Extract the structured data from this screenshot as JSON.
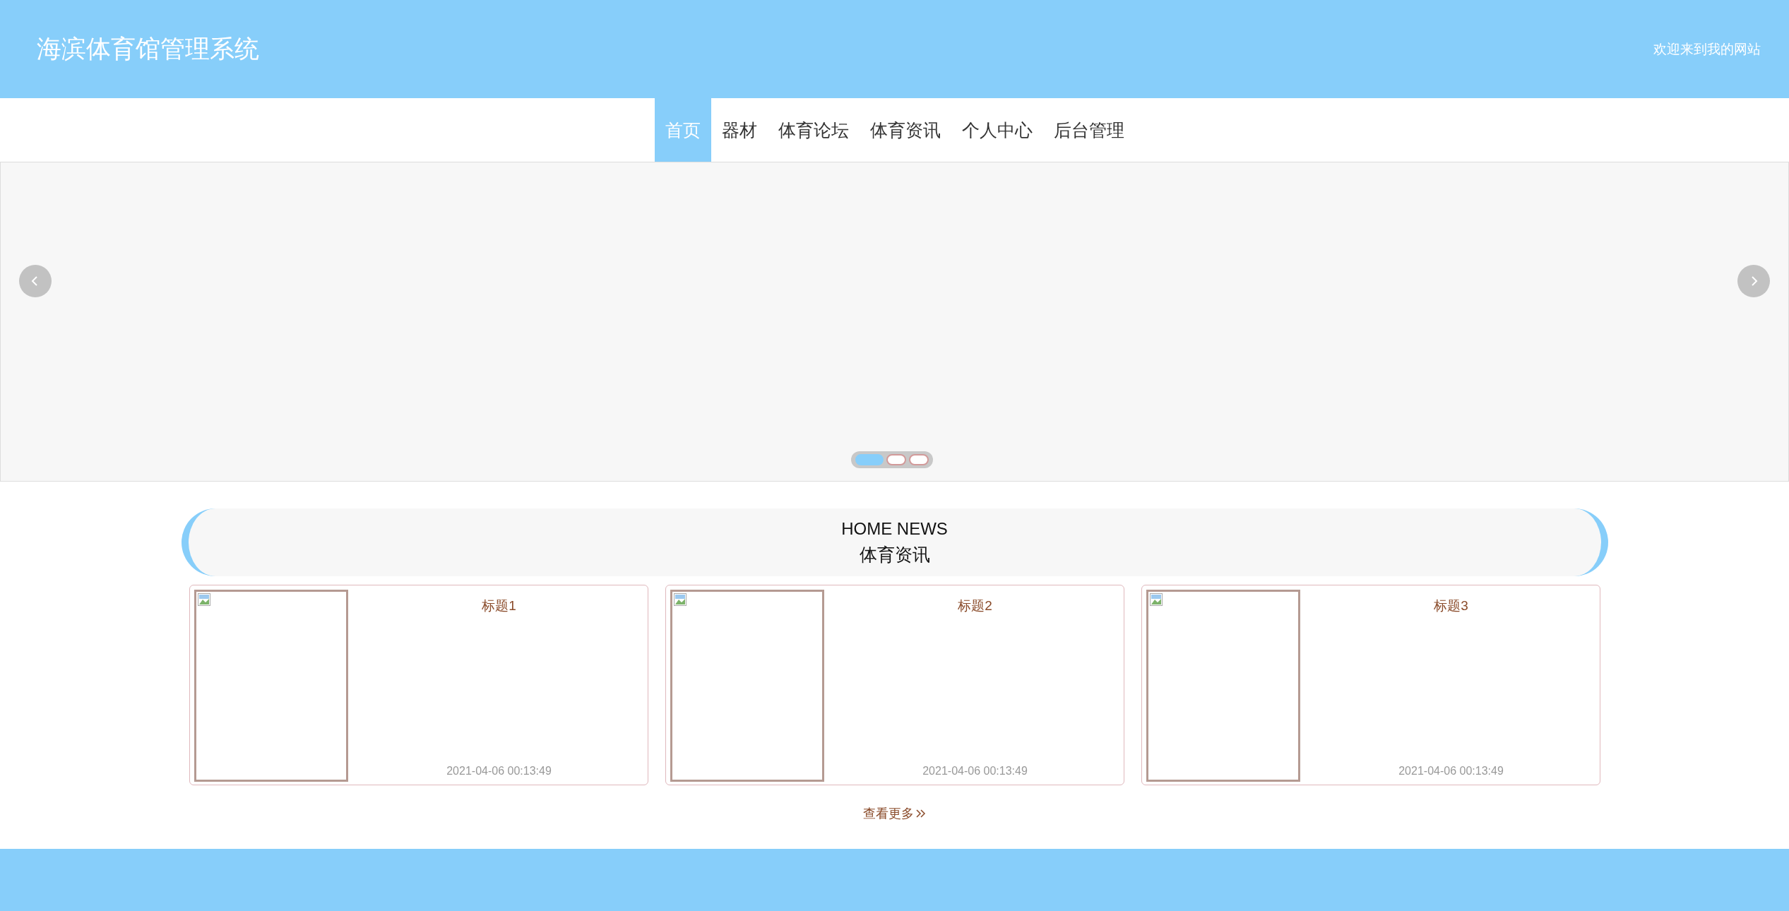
{
  "header": {
    "title": "海滨体育馆管理系统",
    "welcome": "欢迎来到我的网站"
  },
  "nav": [
    {
      "label": "首页",
      "selected": true
    },
    {
      "label": "器材",
      "selected": false
    },
    {
      "label": "体育论坛",
      "selected": false
    },
    {
      "label": "体育资讯",
      "selected": false
    },
    {
      "label": "个人中心",
      "selected": false
    },
    {
      "label": "后台管理",
      "selected": false
    }
  ],
  "carousel": {
    "dots": [
      {
        "selected": true
      },
      {
        "selected": false
      },
      {
        "selected": false
      }
    ]
  },
  "news": {
    "title_en": "HOME NEWS",
    "title": "体育资讯",
    "items": [
      {
        "title": "标题1",
        "date": "2021-04-06 00:13:49"
      },
      {
        "title": "标题2",
        "date": "2021-04-06 00:13:49"
      },
      {
        "title": "标题3",
        "date": "2021-04-06 00:13:49"
      }
    ],
    "more": "查看更多"
  }
}
